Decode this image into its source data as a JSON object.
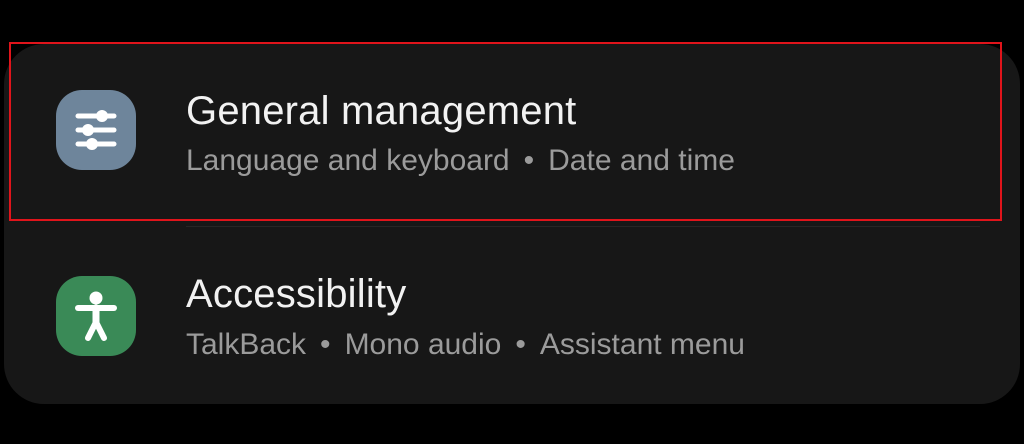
{
  "settings": {
    "items": [
      {
        "title": "General management",
        "subtitle_parts": [
          "Language and keyboard",
          "Date and time"
        ],
        "icon": "sliders-icon",
        "icon_bg": "#6e859b"
      },
      {
        "title": "Accessibility",
        "subtitle_parts": [
          "TalkBack",
          "Mono audio",
          "Assistant menu"
        ],
        "icon": "accessibility-person-icon",
        "icon_bg": "#3a8a57"
      }
    ],
    "separator": "•"
  },
  "colors": {
    "background": "#000000",
    "card": "#171717",
    "title_text": "#f2f2f2",
    "subtitle_text": "#9b9b9b",
    "highlight_border": "#e0141b"
  }
}
